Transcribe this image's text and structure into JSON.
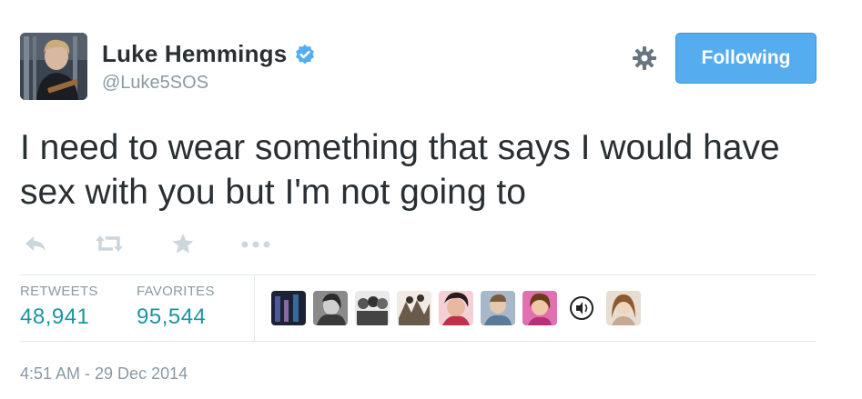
{
  "user": {
    "name": "Luke Hemmings",
    "handle": "@Luke5SOS",
    "verified": true,
    "avatar_icon": "profile-photo"
  },
  "header": {
    "settings_icon": "gear-icon",
    "follow_button_label": "Following"
  },
  "tweet": {
    "text": "I need to wear something that says I would have sex with you but I'm not going to"
  },
  "actions": [
    "reply-icon",
    "retweet-icon",
    "favorite-icon",
    "more-icon"
  ],
  "stats": {
    "retweets_label": "RETWEETS",
    "retweets_value": "48,941",
    "favorites_label": "FAVORITES",
    "favorites_value": "95,544"
  },
  "favorited_by": [
    {
      "icon": "user-avatar-1",
      "color": "#2b2f4a"
    },
    {
      "icon": "user-avatar-2",
      "color": "#6b6b6b"
    },
    {
      "icon": "user-avatar-3",
      "color": "#4a4a4a"
    },
    {
      "icon": "user-avatar-4",
      "color": "#7a6a5a"
    },
    {
      "icon": "user-avatar-5",
      "color": "#b03a4a"
    },
    {
      "icon": "user-avatar-6",
      "color": "#8aa0b8"
    },
    {
      "icon": "user-avatar-7",
      "color": "#d45a9a"
    },
    {
      "icon": "user-avatar-8",
      "color": "#ffffff"
    },
    {
      "icon": "user-avatar-9",
      "color": "#c9a88a"
    }
  ],
  "timestamp": "4:51 AM - 29 Dec 2014",
  "colors": {
    "accent": "#55acee",
    "verified": "#55acee",
    "stat_value": "#1b95a0",
    "muted": "#8899a6"
  }
}
